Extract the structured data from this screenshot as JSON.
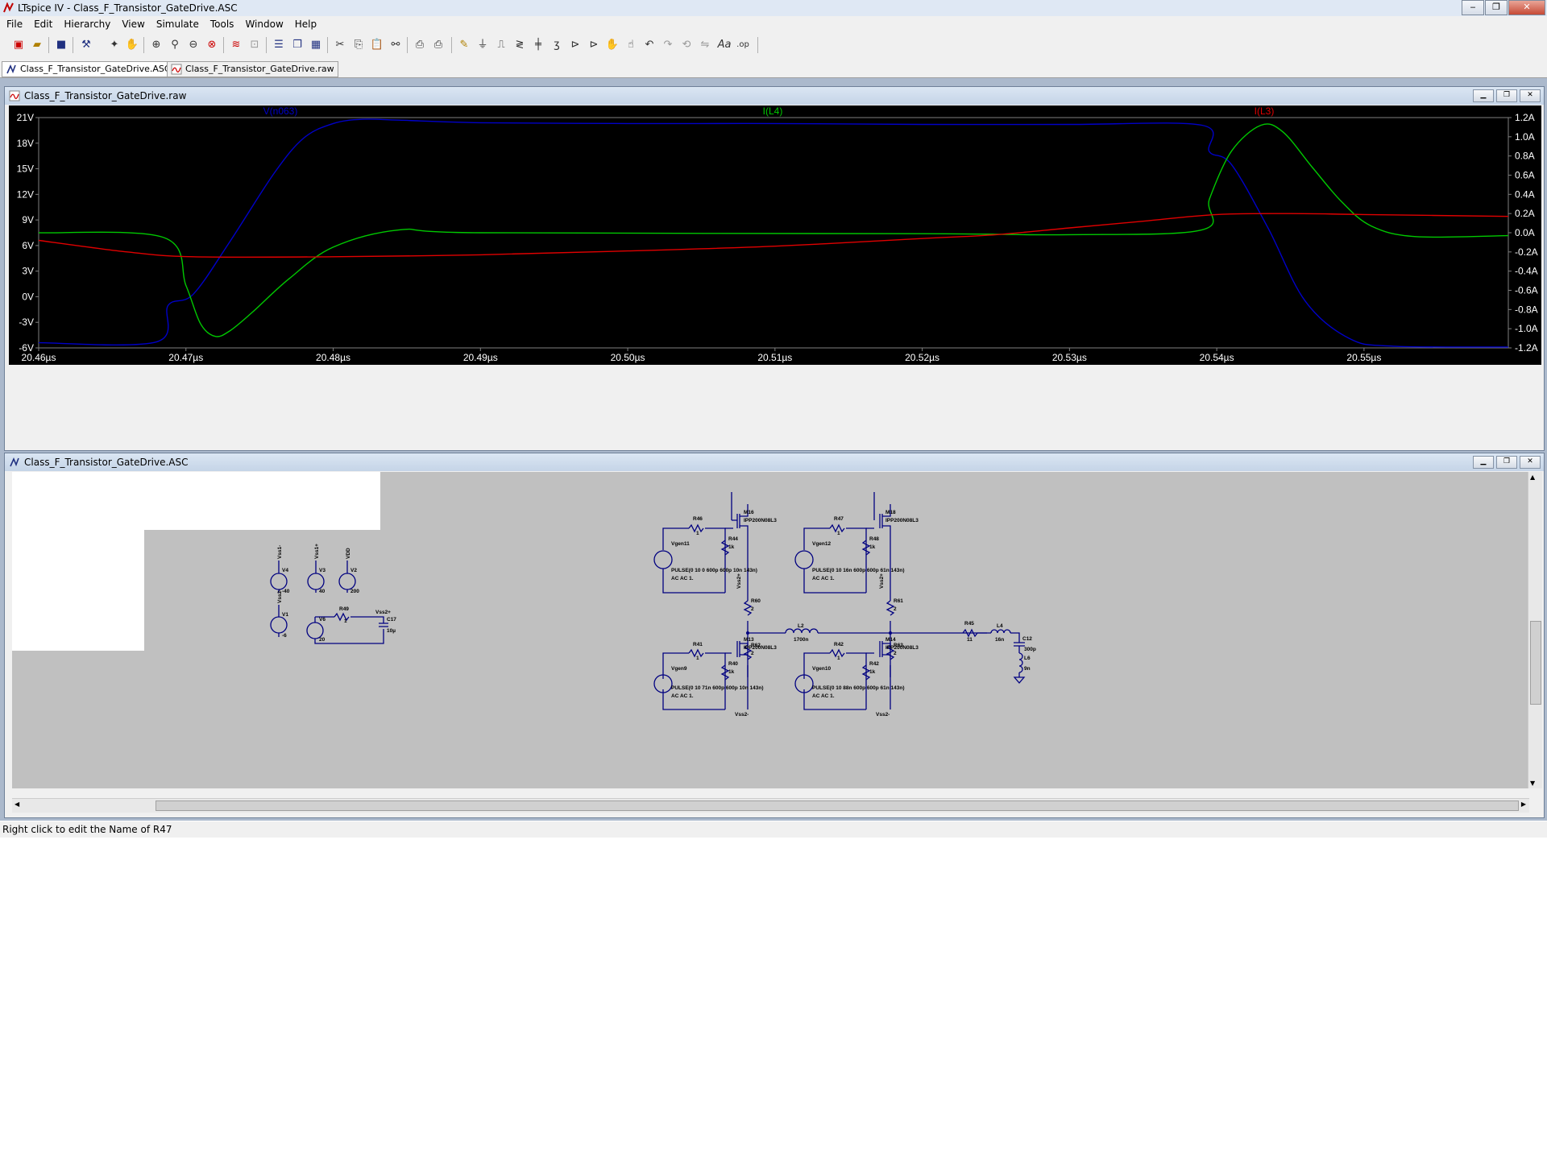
{
  "window": {
    "title": "LTspice IV - Class_F_Transistor_GateDrive.ASC",
    "minimize": "‒",
    "maximize": "❐",
    "close": "✕"
  },
  "menu": [
    "File",
    "Edit",
    "Hierarchy",
    "View",
    "Simulate",
    "Tools",
    "Window",
    "Help"
  ],
  "tabs": [
    "Class_F_Transistor_GateDrive.ASC",
    "Class_F_Transistor_GateDrive.raw"
  ],
  "waveform_window": {
    "title": "Class_F_Transistor_GateDrive.raw",
    "traces": [
      {
        "name": "V(n063)",
        "color": "#0000c8"
      },
      {
        "name": "I(L4)",
        "color": "#00c800"
      },
      {
        "name": "I(L3)",
        "color": "#e00000"
      }
    ],
    "left_axis": [
      "21V",
      "18V",
      "15V",
      "12V",
      "9V",
      "6V",
      "3V",
      "0V",
      "-3V",
      "-6V"
    ],
    "right_axis": [
      "1.2A",
      "1.0A",
      "0.8A",
      "0.6A",
      "0.4A",
      "0.2A",
      "0.0A",
      "-0.2A",
      "-0.4A",
      "-0.6A",
      "-0.8A",
      "-1.0A",
      "-1.2A"
    ],
    "x_axis": [
      "20.46µs",
      "20.47µs",
      "20.48µs",
      "20.49µs",
      "20.50µs",
      "20.51µs",
      "20.52µs",
      "20.53µs",
      "20.54µs",
      "20.55µs"
    ]
  },
  "chart_data": {
    "type": "line",
    "x_unit": "µs",
    "xlim": [
      20.46,
      20.5598
    ],
    "left_ylim": [
      -6,
      21
    ],
    "right_ylim": [
      -1.2,
      1.2
    ],
    "series": [
      {
        "name": "V(n063)",
        "axis": "left",
        "color": "#0000c8",
        "x": [
          20.46,
          20.468,
          20.4688,
          20.4705,
          20.473,
          20.476,
          20.478,
          20.48,
          20.482,
          20.4845,
          20.49,
          20.5,
          20.51,
          20.52,
          20.53,
          20.539,
          20.5395,
          20.541,
          20.5435,
          20.546,
          20.549,
          20.552,
          20.5598
        ],
        "y": [
          -5.4,
          -5.3,
          -1,
          0.3,
          6.5,
          14.5,
          18.6,
          20.3,
          20.8,
          20.7,
          20.4,
          20.3,
          20.3,
          20.2,
          20.2,
          20.1,
          17,
          15.5,
          8,
          -0.5,
          -4.9,
          -5.8,
          -5.9
        ]
      },
      {
        "name": "I(L4)",
        "axis": "right",
        "color": "#00c800",
        "x": [
          20.46,
          20.4685,
          20.47,
          20.471,
          20.472,
          20.473,
          20.4745,
          20.477,
          20.48,
          20.4845,
          20.49,
          20.52,
          20.53,
          20.539,
          20.5395,
          20.541,
          20.543,
          20.5445,
          20.5465,
          20.5485,
          20.5505,
          20.5535,
          20.5598
        ],
        "y": [
          0.0,
          -0.05,
          -0.55,
          -0.95,
          -1.08,
          -1.02,
          -0.83,
          -0.48,
          -0.15,
          0.03,
          0.0,
          -0.01,
          -0.02,
          0.03,
          0.35,
          0.85,
          1.12,
          1.05,
          0.68,
          0.32,
          0.07,
          -0.04,
          -0.03
        ]
      },
      {
        "name": "I(L3)",
        "axis": "right",
        "color": "#e00000",
        "x": [
          20.46,
          20.466,
          20.4705,
          20.48,
          20.49,
          20.5,
          20.51,
          20.52,
          20.525,
          20.53,
          20.535,
          20.54,
          20.545,
          20.55,
          20.5598
        ],
        "y": [
          -0.08,
          -0.2,
          -0.25,
          -0.25,
          -0.23,
          -0.19,
          -0.14,
          -0.06,
          -0.02,
          0.05,
          0.12,
          0.19,
          0.2,
          0.19,
          0.17
        ]
      }
    ]
  },
  "schematic_window": {
    "title": "Class_F_Transistor_GateDrive.ASC",
    "labels": {
      "R46": "R46",
      "R46v": "1",
      "R44": "R44",
      "R44v": "1k",
      "M16": "M16",
      "M16v": "IPP200N08L3",
      "Vgen11": "Vgen11",
      "pulse11": "PULSE(0 10 0 600p 600p 10n 143n)",
      "ac11": "AC AC 1.",
      "R47": "R47",
      "R47v": "1",
      "R48": "R48",
      "R48v": "1k",
      "M18": "M18",
      "M18v": "IPP200N08L3",
      "Vgen12": "Vgen12",
      "pulse12": "PULSE(0 10 16n 600p 600p 61n 143n)",
      "ac12": "AC AC 1.",
      "R60": "R60",
      "R60v": "2",
      "R61": "R61",
      "R61v": "2",
      "R62": "R62",
      "R62v": "2",
      "R63": "R63",
      "R63v": "2",
      "L2": "L2",
      "L2v": "1700n",
      "R45": "R45",
      "R45v": "11",
      "L4": "L4",
      "L4v": "16n",
      "C12": "C12",
      "C12v": "300p",
      "L6": "L6",
      "L6v": "9n",
      "R41": "R41",
      "R41v": "1",
      "R40": "R40",
      "R40v": "1k",
      "M13": "M13",
      "M13v": "IPP200N08L3",
      "Vgen9": "Vgen9",
      "pulse9": "PULSE(0 10 71n 600p 600p 10n 143n)",
      "ac9": "AC AC 1.",
      "R42": "R42",
      "R42v": "1",
      "R43": "R42",
      "R43v": "1k",
      "M14": "M14",
      "M14v": "IPP200N08L3",
      "Vgen10": "Vgen10",
      "pulse10": "PULSE(0 10 88n 600p 600p 61n 143n)",
      "ac10": "AC AC 1.",
      "Vss2": "Vss2-",
      "Vss2b": "Vss2-",
      "Vss2plus1": "Vss2+",
      "Vss2plus2": "Vss2+",
      "V4": "V4",
      "V4v": "-40",
      "V3": "V3",
      "V3v": "40",
      "V2": "V2",
      "V2v": "200",
      "Vss1m": "Vss1-",
      "Vss1p": "Vss1+",
      "VDD": "VDD",
      "V1": "V1",
      "V1v": "-6",
      "V6": "V6",
      "V6v": "20",
      "R49": "R49",
      "R49v": "1",
      "C17": "C17",
      "C17v": "10µ",
      "Vss2m": "Vss2-",
      "Vss2pl": "Vss2+"
    }
  },
  "status": "Right click to edit the Name of R47"
}
